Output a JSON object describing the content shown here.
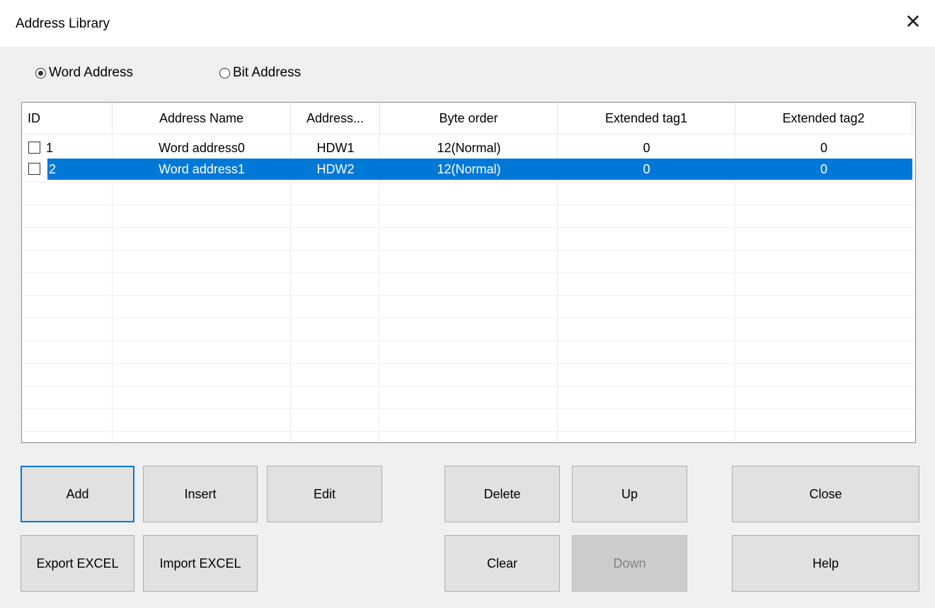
{
  "window": {
    "title": "Address Library"
  },
  "radios": {
    "word_address": {
      "label": "Word Address",
      "selected": true
    },
    "bit_address": {
      "label": "Bit Address",
      "selected": false
    }
  },
  "table": {
    "columns": [
      "ID",
      "Address Name",
      "Address...",
      "Byte order",
      "Extended tag1",
      "Extended tag2"
    ],
    "rows": [
      {
        "id": "1",
        "name": "Word address0",
        "address": "HDW1",
        "byte_order": "12(Normal)",
        "ext1": "0",
        "ext2": "0",
        "checked": false,
        "selected": false
      },
      {
        "id": "2",
        "name": "Word address1",
        "address": "HDW2",
        "byte_order": "12(Normal)",
        "ext1": "0",
        "ext2": "0",
        "checked": false,
        "selected": true
      }
    ]
  },
  "buttons": {
    "add": "Add",
    "insert": "Insert",
    "edit": "Edit",
    "delete": "Delete",
    "up": "Up",
    "close": "Close",
    "export_excel": "Export EXCEL",
    "import_excel": "Import EXCEL",
    "clear": "Clear",
    "down": "Down",
    "help": "Help"
  },
  "icons": {
    "close": "close-icon",
    "checkbox": "checkbox-icon"
  },
  "colors": {
    "selection": "#0078d7",
    "button": "#e1e1e1",
    "disabled_text": "#838383"
  }
}
